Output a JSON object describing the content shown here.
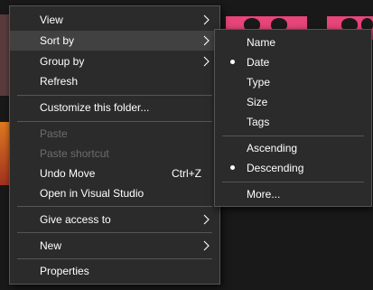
{
  "context_menu": {
    "items": [
      {
        "label": "View"
      },
      {
        "label": "Sort by"
      },
      {
        "label": "Group by"
      },
      {
        "label": "Refresh"
      },
      {
        "label": "Customize this folder..."
      },
      {
        "label": "Paste"
      },
      {
        "label": "Paste shortcut"
      },
      {
        "label": "Undo Move",
        "shortcut": "Ctrl+Z"
      },
      {
        "label": "Open in Visual Studio"
      },
      {
        "label": "Give access to"
      },
      {
        "label": "New"
      },
      {
        "label": "Properties"
      }
    ]
  },
  "sort_submenu": {
    "fields": [
      {
        "label": "Name",
        "selected": false
      },
      {
        "label": "Date",
        "selected": true
      },
      {
        "label": "Type",
        "selected": false
      },
      {
        "label": "Size",
        "selected": false
      },
      {
        "label": "Tags",
        "selected": false
      }
    ],
    "order": [
      {
        "label": "Ascending",
        "selected": false
      },
      {
        "label": "Descending",
        "selected": true
      }
    ],
    "more": "More..."
  },
  "colors": {
    "menu_bg": "#2b2b2b",
    "hover": "#414141",
    "disabled_text": "#6d6d6d",
    "thumbnail_pink": "#e8457a"
  }
}
